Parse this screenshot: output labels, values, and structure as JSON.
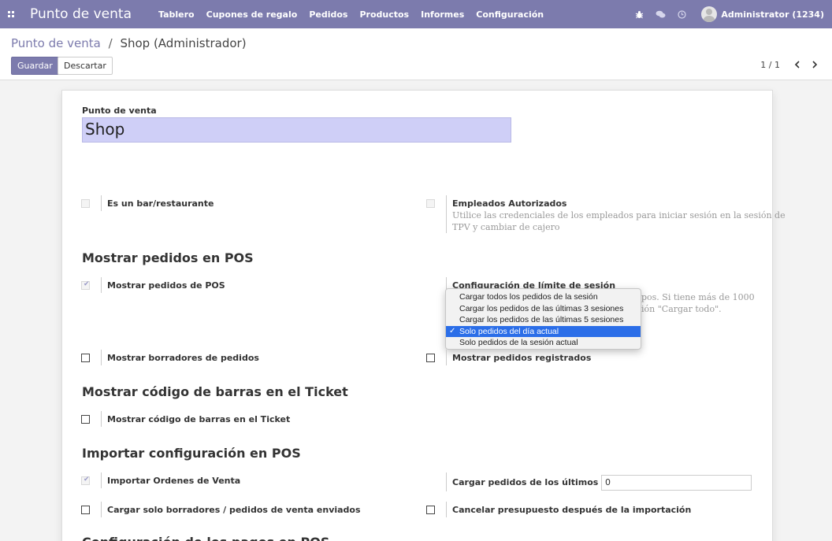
{
  "navbar": {
    "brand": "Punto de venta",
    "menu": [
      "Tablero",
      "Cupones de regalo",
      "Pedidos",
      "Productos",
      "Informes",
      "Configuración"
    ],
    "user": "Administrator (1234)",
    "icons": [
      "apps-icon",
      "bug-icon",
      "chat-icon",
      "clock-icon"
    ]
  },
  "breadcrumb": {
    "parent": "Punto de venta",
    "separator": "/",
    "current": "Shop (Administrador)"
  },
  "buttons": {
    "save": "Guardar",
    "discard": "Descartar"
  },
  "pager": {
    "value": "1 / 1"
  },
  "form": {
    "name_label": "Punto de venta",
    "name_value": "Shop",
    "bar_restaurant": {
      "label": "Es un bar/restaurante",
      "checked": false
    },
    "employees": {
      "label": "Empleados Autorizados",
      "help_line1": "Utilice las credenciales de los empleados para iniciar sesión en la sesión de",
      "help_line2": "TPV y cambiar de cajero",
      "checked": false
    },
    "section_orders": "Mostrar pedidos en POS",
    "show_pos_orders": {
      "label": "Mostrar pedidos de POS",
      "checked": true
    },
    "session_limit": {
      "label": "Configuración de límite de sesión",
      "help_line1_visible": "pos. Si tiene más de 1000",
      "help_line2_visible": "ión \"Cargar todo\"."
    },
    "dropdown": {
      "options": [
        "Cargar todos los pedidos de la sesión",
        "Cargar los pedidos de las últimas 3 sesiones",
        "Cargar los pedidos de las últimas 5 sesiones",
        "Solo pedidos del día actual",
        "Solo pedidos de la sesión actual"
      ],
      "selected_index": 3
    },
    "show_drafts": {
      "label": "Mostrar borradores de pedidos",
      "checked": false
    },
    "show_posted": {
      "label": "Mostrar pedidos registrados",
      "checked": false
    },
    "section_barcode": "Mostrar código de barras en el Ticket",
    "barcode_ticket": {
      "label": "Mostrar código de barras en el Ticket",
      "checked": false
    },
    "section_import": "Importar configuración en POS",
    "import_sales": {
      "label": "Importar Ordenes de Venta",
      "checked": true
    },
    "load_last_days": {
      "label": "Cargar pedidos de los últimos días",
      "value": "0"
    },
    "load_only_drafts": {
      "label": "Cargar solo borradores / pedidos de venta enviados",
      "checked": false
    },
    "cancel_quote": {
      "label": "Cancelar presupuesto después de la importación",
      "checked": false
    },
    "section_next_partial": "Configuración de los pagos en POS"
  }
}
